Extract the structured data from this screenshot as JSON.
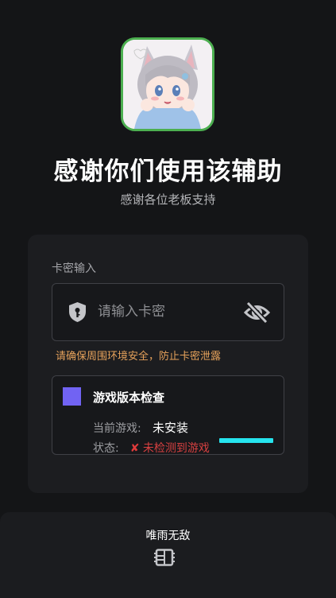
{
  "header": {
    "avatar_alt": "anime-girl-avatar",
    "title": "感谢你们使用该辅助",
    "subtitle": "感谢各位老板支持"
  },
  "card_input": {
    "section_label": "卡密输入",
    "placeholder": "请输入卡密",
    "warning": "请确保周围环境安全，防止卡密泄露"
  },
  "version_check": {
    "title": "游戏版本检查",
    "current_game_label": "当前游戏:",
    "current_game_value": "未安装",
    "status_label": "状态:",
    "status_text": "未检测到游戏"
  },
  "footer": {
    "title": "唯雨无敌"
  },
  "colors": {
    "accent_green": "#4caf50",
    "accent_purple": "#7163f3",
    "warning_orange": "#e6a25b",
    "progress_cyan": "#26e4ee",
    "error_red": "#e03b3b"
  }
}
